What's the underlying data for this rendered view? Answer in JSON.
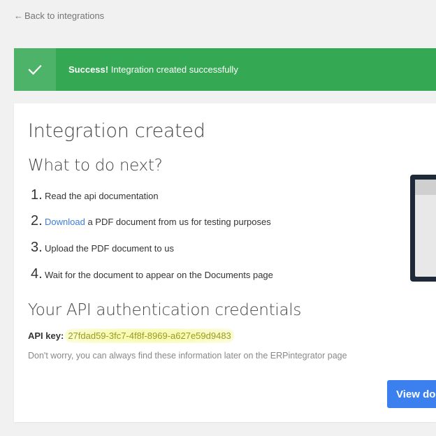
{
  "nav": {
    "back_arrow": "←",
    "back_label": "Back to integrations"
  },
  "alert": {
    "icon": "check-icon",
    "title": "Success!",
    "message": "Integration created successfully",
    "color": "#34a853"
  },
  "page": {
    "title": "Integration created",
    "next_heading": "What to do next?",
    "steps": [
      {
        "number": "1.",
        "text": "Read the api documentation"
      },
      {
        "number": "2.",
        "link": "Download",
        "text": "a PDF document from us for testing purposes"
      },
      {
        "number": "3.",
        "text": "Upload the PDF document to us"
      },
      {
        "number": "4.",
        "text": "Wait for the document to appear on the Documents page"
      }
    ],
    "credentials_heading": "Your API authentication credentials",
    "api_key_label": "API key:",
    "api_key_value": "27fdad59-3fc7-4f8f-8969-a627e59d9483",
    "note": "Don't worry, you can always find these information later on the ERPintegrator page",
    "view_button": "View documentation"
  },
  "colors": {
    "link": "#3b7ddd",
    "button": "#3b80ee",
    "highlight": "#f8fbb1"
  }
}
